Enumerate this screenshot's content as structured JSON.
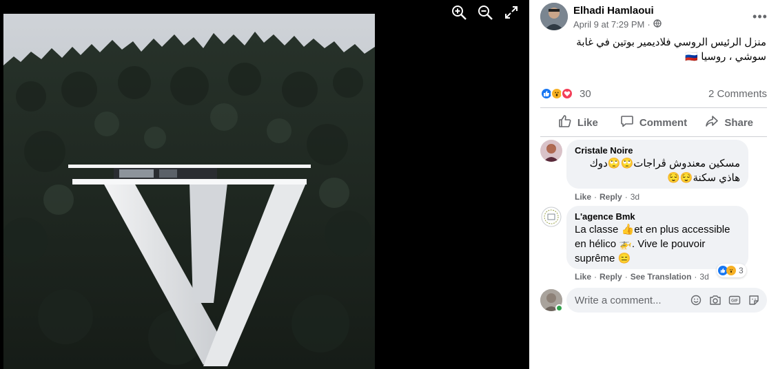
{
  "post": {
    "author": "Elhadi Hamlaoui",
    "time": "April 9 at 7:29 PM",
    "separator": "·",
    "audience_icon": "globe-icon",
    "text_line1": "منزل الرئيس الروسي فلاديمير بوتين في غابة",
    "text_line2": "سوشي ، روسيا 🇷🇺"
  },
  "stats": {
    "reaction_icons": [
      "like-icon",
      "wow-icon",
      "love-icon"
    ],
    "reaction_count": "30",
    "comments_count": "2 Comments"
  },
  "actions": {
    "like": "Like",
    "comment": "Comment",
    "share": "Share"
  },
  "comments": [
    {
      "name": "Cristale Noire",
      "line1": "مسكين معندوش ڨراجات🙄🙄دوك",
      "line2": "هاذي سكنة😌😌",
      "like": "Like",
      "reply": "Reply",
      "time": "3d"
    },
    {
      "name": "L'agence Bmk",
      "line1": "La classe 👍et en plus accessible",
      "line2": "en hélico 🚁. Vive le pouvoir",
      "line3": "suprême 😑",
      "like": "Like",
      "reply": "Reply",
      "see_translation": "See Translation",
      "time": "3d",
      "reaction_count": "3"
    }
  ],
  "composer": {
    "placeholder": "Write a comment...",
    "icons": [
      "emoji-icon",
      "camera-icon",
      "gif-icon",
      "sticker-icon"
    ]
  },
  "viewer": {
    "tools": [
      "zoom-in-icon",
      "zoom-out-icon",
      "fullscreen-icon"
    ]
  },
  "colors": {
    "like_blue": "#1877f2",
    "love_red": "#f33e58",
    "wow_yellow": "#f7b125",
    "muted": "#65676b"
  }
}
